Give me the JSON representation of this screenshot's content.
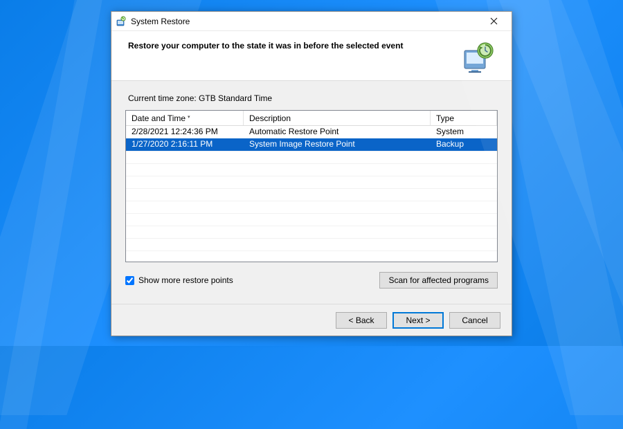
{
  "titlebar": {
    "title": "System Restore"
  },
  "header": {
    "heading": "Restore your computer to the state it was in before the selected event"
  },
  "timezone_label": "Current time zone: GTB Standard Time",
  "columns": {
    "date": "Date and Time",
    "desc": "Description",
    "type": "Type"
  },
  "sort": {
    "column": "date",
    "direction": "desc"
  },
  "rows": [
    {
      "date": "2/28/2021 12:24:36 PM",
      "desc": "Automatic Restore Point",
      "type": "System",
      "selected": false
    },
    {
      "date": "1/27/2020 2:16:11 PM",
      "desc": "System Image Restore Point",
      "type": "Backup",
      "selected": true
    }
  ],
  "checkbox": {
    "label": "Show more restore points",
    "checked": true
  },
  "buttons": {
    "scan": "Scan for affected programs",
    "back": "< Back",
    "next": "Next >",
    "cancel": "Cancel"
  },
  "icons": {
    "app": "restore-icon",
    "header": "restore-header-icon",
    "close": "close-icon"
  },
  "colors": {
    "selection": "#0a64c8",
    "accent": "#0078d7"
  }
}
